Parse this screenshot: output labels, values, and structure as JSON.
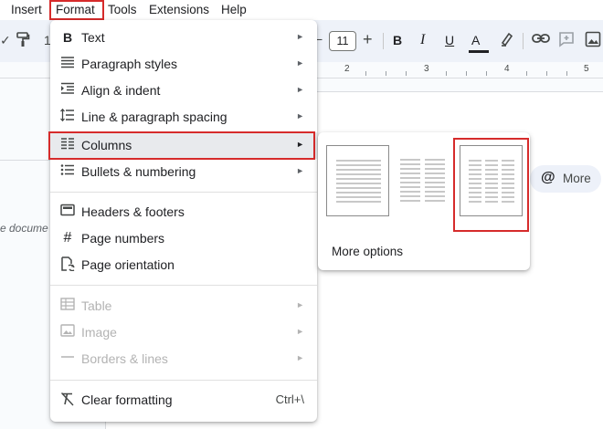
{
  "menubar": {
    "insert": "Insert",
    "format": "Format",
    "tools": "Tools",
    "extensions": "Extensions",
    "help": "Help"
  },
  "toolbar": {
    "font_size": "11",
    "zoom_fragment": "1"
  },
  "ruler": {
    "numbers": [
      "2",
      "3",
      "4",
      "5"
    ]
  },
  "document": {
    "side_text": "e docume"
  },
  "format_menu": {
    "items": [
      {
        "label": "Text",
        "icon": "bold-icon",
        "arrow": "►"
      },
      {
        "label": "Paragraph styles",
        "icon": "paragraph-styles-icon",
        "arrow": "►"
      },
      {
        "label": "Align & indent",
        "icon": "align-indent-icon",
        "arrow": "►"
      },
      {
        "label": "Line & paragraph spacing",
        "icon": "line-spacing-icon",
        "arrow": "►"
      },
      {
        "label": "Columns",
        "icon": "columns-icon",
        "arrow": "►"
      },
      {
        "label": "Bullets & numbering",
        "icon": "bulleted-list-icon",
        "arrow": "►"
      },
      {
        "label": "Headers & footers",
        "icon": "header-footer-icon"
      },
      {
        "label": "Page numbers",
        "icon": "hash-icon"
      },
      {
        "label": "Page orientation",
        "icon": "page-orientation-icon"
      },
      {
        "label": "Table",
        "icon": "table-icon",
        "arrow": "►"
      },
      {
        "label": "Image",
        "icon": "image-icon",
        "arrow": "►"
      },
      {
        "label": "Borders & lines",
        "icon": "horizontal-line-icon",
        "arrow": "►"
      },
      {
        "label": "Clear formatting",
        "icon": "clear-formatting-icon",
        "shortcut": "Ctrl+\\"
      }
    ]
  },
  "columns_submenu": {
    "options": [
      "one-column",
      "two-columns",
      "three-columns"
    ],
    "more_options": "More options"
  },
  "more_chip": {
    "label": "More"
  },
  "colors": {
    "highlight_red": "#d62b2b",
    "menu_active": "#e8eaed",
    "toolbar_bg": "#eef2f9"
  }
}
